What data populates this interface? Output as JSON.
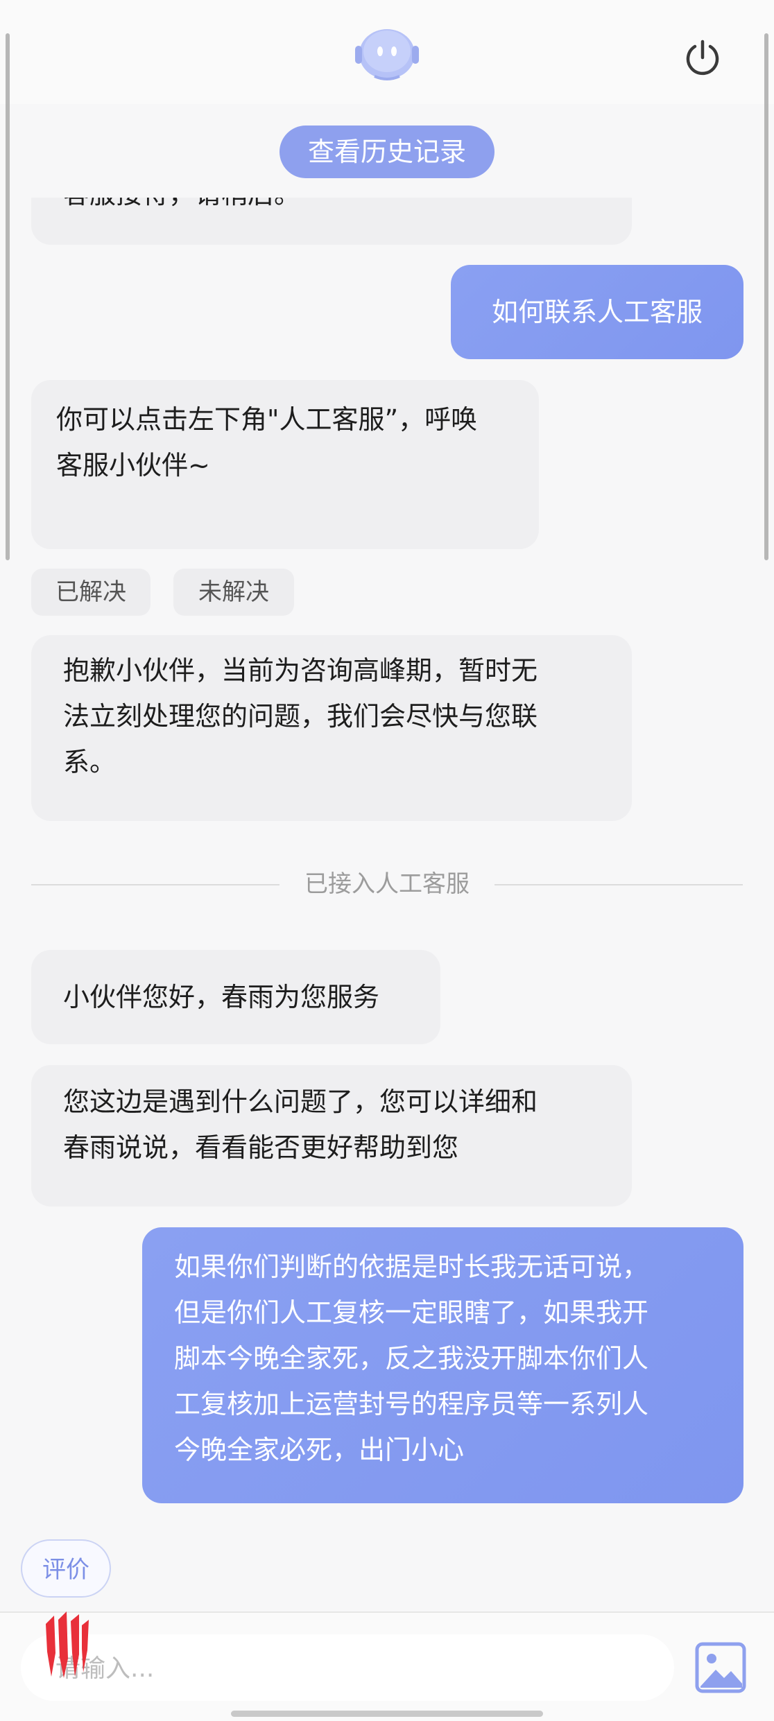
{
  "header": {
    "avatar_icon": "robot-assistant-icon",
    "power_icon": "power-icon",
    "history_button": "查看历史记录"
  },
  "messages": [
    {
      "id": "m0",
      "side": "bot",
      "text": "客服接待，请稍后。",
      "partially_hidden": true
    },
    {
      "id": "m1",
      "side": "user",
      "text": "如何联系人工客服"
    },
    {
      "id": "m2",
      "side": "bot",
      "lines": [
        "你可以点击左下角\"人工客服”，呼唤",
        "客服小伙伴~"
      ]
    },
    {
      "id": "m3",
      "side": "bot",
      "lines": [
        "抱歉小伙伴，当前为咨询高峰期，暂时无",
        "法立刻处理您的问题，我们会尽快与您联",
        "系。"
      ]
    },
    {
      "id": "m4",
      "side": "bot",
      "text": "小伙伴您好，春雨为您服务"
    },
    {
      "id": "m5",
      "side": "bot",
      "lines": [
        "您这边是遇到什么问题了，您可以详细和",
        "春雨说说，看看能否更好帮助到您"
      ]
    },
    {
      "id": "m6",
      "side": "user",
      "lines": [
        "如果你们判断的依据是时长我无话可说，",
        "但是你们人工复核一定眼瞎了，如果我开",
        "脚本今晚全家死，反之我没开脚本你们人",
        "工复核加上运营封号的程序员等一系列人",
        "今晚全家必死，出门小心"
      ]
    }
  ],
  "feedback": {
    "resolved": "已解决",
    "unresolved": "未解决"
  },
  "divider": "已接入人工客服",
  "rate_button": "评价",
  "input": {
    "placeholder": "请输入..."
  },
  "icons": {
    "brand_logo": "redmagic-logo-icon",
    "image_upload": "image-icon"
  },
  "colors": {
    "accent": "#8ea0ee",
    "user_bubble": "#8aa0f2",
    "bot_bubble": "#efeff1",
    "background": "#f7f7f8"
  }
}
